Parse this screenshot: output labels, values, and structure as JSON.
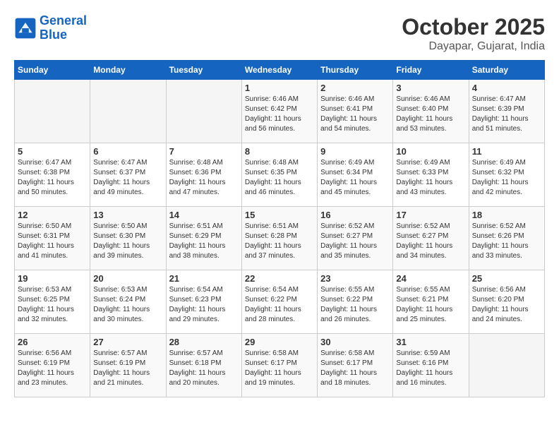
{
  "header": {
    "logo_line1": "General",
    "logo_line2": "Blue",
    "month": "October 2025",
    "location": "Dayapar, Gujarat, India"
  },
  "days_of_week": [
    "Sunday",
    "Monday",
    "Tuesday",
    "Wednesday",
    "Thursday",
    "Friday",
    "Saturday"
  ],
  "weeks": [
    [
      {
        "day": "",
        "content": ""
      },
      {
        "day": "",
        "content": ""
      },
      {
        "day": "",
        "content": ""
      },
      {
        "day": "1",
        "content": "Sunrise: 6:46 AM\nSunset: 6:42 PM\nDaylight: 11 hours\nand 56 minutes."
      },
      {
        "day": "2",
        "content": "Sunrise: 6:46 AM\nSunset: 6:41 PM\nDaylight: 11 hours\nand 54 minutes."
      },
      {
        "day": "3",
        "content": "Sunrise: 6:46 AM\nSunset: 6:40 PM\nDaylight: 11 hours\nand 53 minutes."
      },
      {
        "day": "4",
        "content": "Sunrise: 6:47 AM\nSunset: 6:39 PM\nDaylight: 11 hours\nand 51 minutes."
      }
    ],
    [
      {
        "day": "5",
        "content": "Sunrise: 6:47 AM\nSunset: 6:38 PM\nDaylight: 11 hours\nand 50 minutes."
      },
      {
        "day": "6",
        "content": "Sunrise: 6:47 AM\nSunset: 6:37 PM\nDaylight: 11 hours\nand 49 minutes."
      },
      {
        "day": "7",
        "content": "Sunrise: 6:48 AM\nSunset: 6:36 PM\nDaylight: 11 hours\nand 47 minutes."
      },
      {
        "day": "8",
        "content": "Sunrise: 6:48 AM\nSunset: 6:35 PM\nDaylight: 11 hours\nand 46 minutes."
      },
      {
        "day": "9",
        "content": "Sunrise: 6:49 AM\nSunset: 6:34 PM\nDaylight: 11 hours\nand 45 minutes."
      },
      {
        "day": "10",
        "content": "Sunrise: 6:49 AM\nSunset: 6:33 PM\nDaylight: 11 hours\nand 43 minutes."
      },
      {
        "day": "11",
        "content": "Sunrise: 6:49 AM\nSunset: 6:32 PM\nDaylight: 11 hours\nand 42 minutes."
      }
    ],
    [
      {
        "day": "12",
        "content": "Sunrise: 6:50 AM\nSunset: 6:31 PM\nDaylight: 11 hours\nand 41 minutes."
      },
      {
        "day": "13",
        "content": "Sunrise: 6:50 AM\nSunset: 6:30 PM\nDaylight: 11 hours\nand 39 minutes."
      },
      {
        "day": "14",
        "content": "Sunrise: 6:51 AM\nSunset: 6:29 PM\nDaylight: 11 hours\nand 38 minutes."
      },
      {
        "day": "15",
        "content": "Sunrise: 6:51 AM\nSunset: 6:28 PM\nDaylight: 11 hours\nand 37 minutes."
      },
      {
        "day": "16",
        "content": "Sunrise: 6:52 AM\nSunset: 6:27 PM\nDaylight: 11 hours\nand 35 minutes."
      },
      {
        "day": "17",
        "content": "Sunrise: 6:52 AM\nSunset: 6:27 PM\nDaylight: 11 hours\nand 34 minutes."
      },
      {
        "day": "18",
        "content": "Sunrise: 6:52 AM\nSunset: 6:26 PM\nDaylight: 11 hours\nand 33 minutes."
      }
    ],
    [
      {
        "day": "19",
        "content": "Sunrise: 6:53 AM\nSunset: 6:25 PM\nDaylight: 11 hours\nand 32 minutes."
      },
      {
        "day": "20",
        "content": "Sunrise: 6:53 AM\nSunset: 6:24 PM\nDaylight: 11 hours\nand 30 minutes."
      },
      {
        "day": "21",
        "content": "Sunrise: 6:54 AM\nSunset: 6:23 PM\nDaylight: 11 hours\nand 29 minutes."
      },
      {
        "day": "22",
        "content": "Sunrise: 6:54 AM\nSunset: 6:22 PM\nDaylight: 11 hours\nand 28 minutes."
      },
      {
        "day": "23",
        "content": "Sunrise: 6:55 AM\nSunset: 6:22 PM\nDaylight: 11 hours\nand 26 minutes."
      },
      {
        "day": "24",
        "content": "Sunrise: 6:55 AM\nSunset: 6:21 PM\nDaylight: 11 hours\nand 25 minutes."
      },
      {
        "day": "25",
        "content": "Sunrise: 6:56 AM\nSunset: 6:20 PM\nDaylight: 11 hours\nand 24 minutes."
      }
    ],
    [
      {
        "day": "26",
        "content": "Sunrise: 6:56 AM\nSunset: 6:19 PM\nDaylight: 11 hours\nand 23 minutes."
      },
      {
        "day": "27",
        "content": "Sunrise: 6:57 AM\nSunset: 6:19 PM\nDaylight: 11 hours\nand 21 minutes."
      },
      {
        "day": "28",
        "content": "Sunrise: 6:57 AM\nSunset: 6:18 PM\nDaylight: 11 hours\nand 20 minutes."
      },
      {
        "day": "29",
        "content": "Sunrise: 6:58 AM\nSunset: 6:17 PM\nDaylight: 11 hours\nand 19 minutes."
      },
      {
        "day": "30",
        "content": "Sunrise: 6:58 AM\nSunset: 6:17 PM\nDaylight: 11 hours\nand 18 minutes."
      },
      {
        "day": "31",
        "content": "Sunrise: 6:59 AM\nSunset: 6:16 PM\nDaylight: 11 hours\nand 16 minutes."
      },
      {
        "day": "",
        "content": ""
      }
    ]
  ]
}
